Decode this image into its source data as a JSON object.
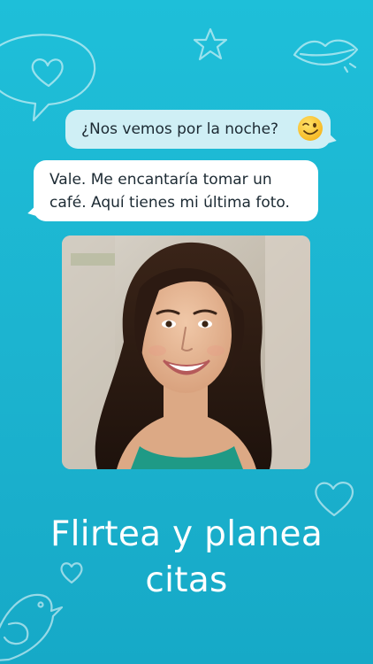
{
  "background": {
    "color_top": "#1ebfd9",
    "color_bottom": "#16a9c7",
    "doodles": [
      "heart-speech-bubble-icon",
      "star-icon",
      "lips-icon",
      "heart-icon",
      "small-heart-icon",
      "bird-icon"
    ]
  },
  "chat": {
    "sent_message": {
      "text": "¿Nos vemos por la noche?",
      "emoji": "wink-emoji-icon",
      "bubble_color": "#cfeff5"
    },
    "received_message": {
      "text": "Vale. Me encantaría tomar un\ncafé. Aquí tienes mi última foto.",
      "bubble_color": "#ffffff"
    },
    "photo": {
      "subject": "profile-photo"
    }
  },
  "headline": {
    "text": "Flirtea y planea\ncitas",
    "color": "#ffffff"
  }
}
